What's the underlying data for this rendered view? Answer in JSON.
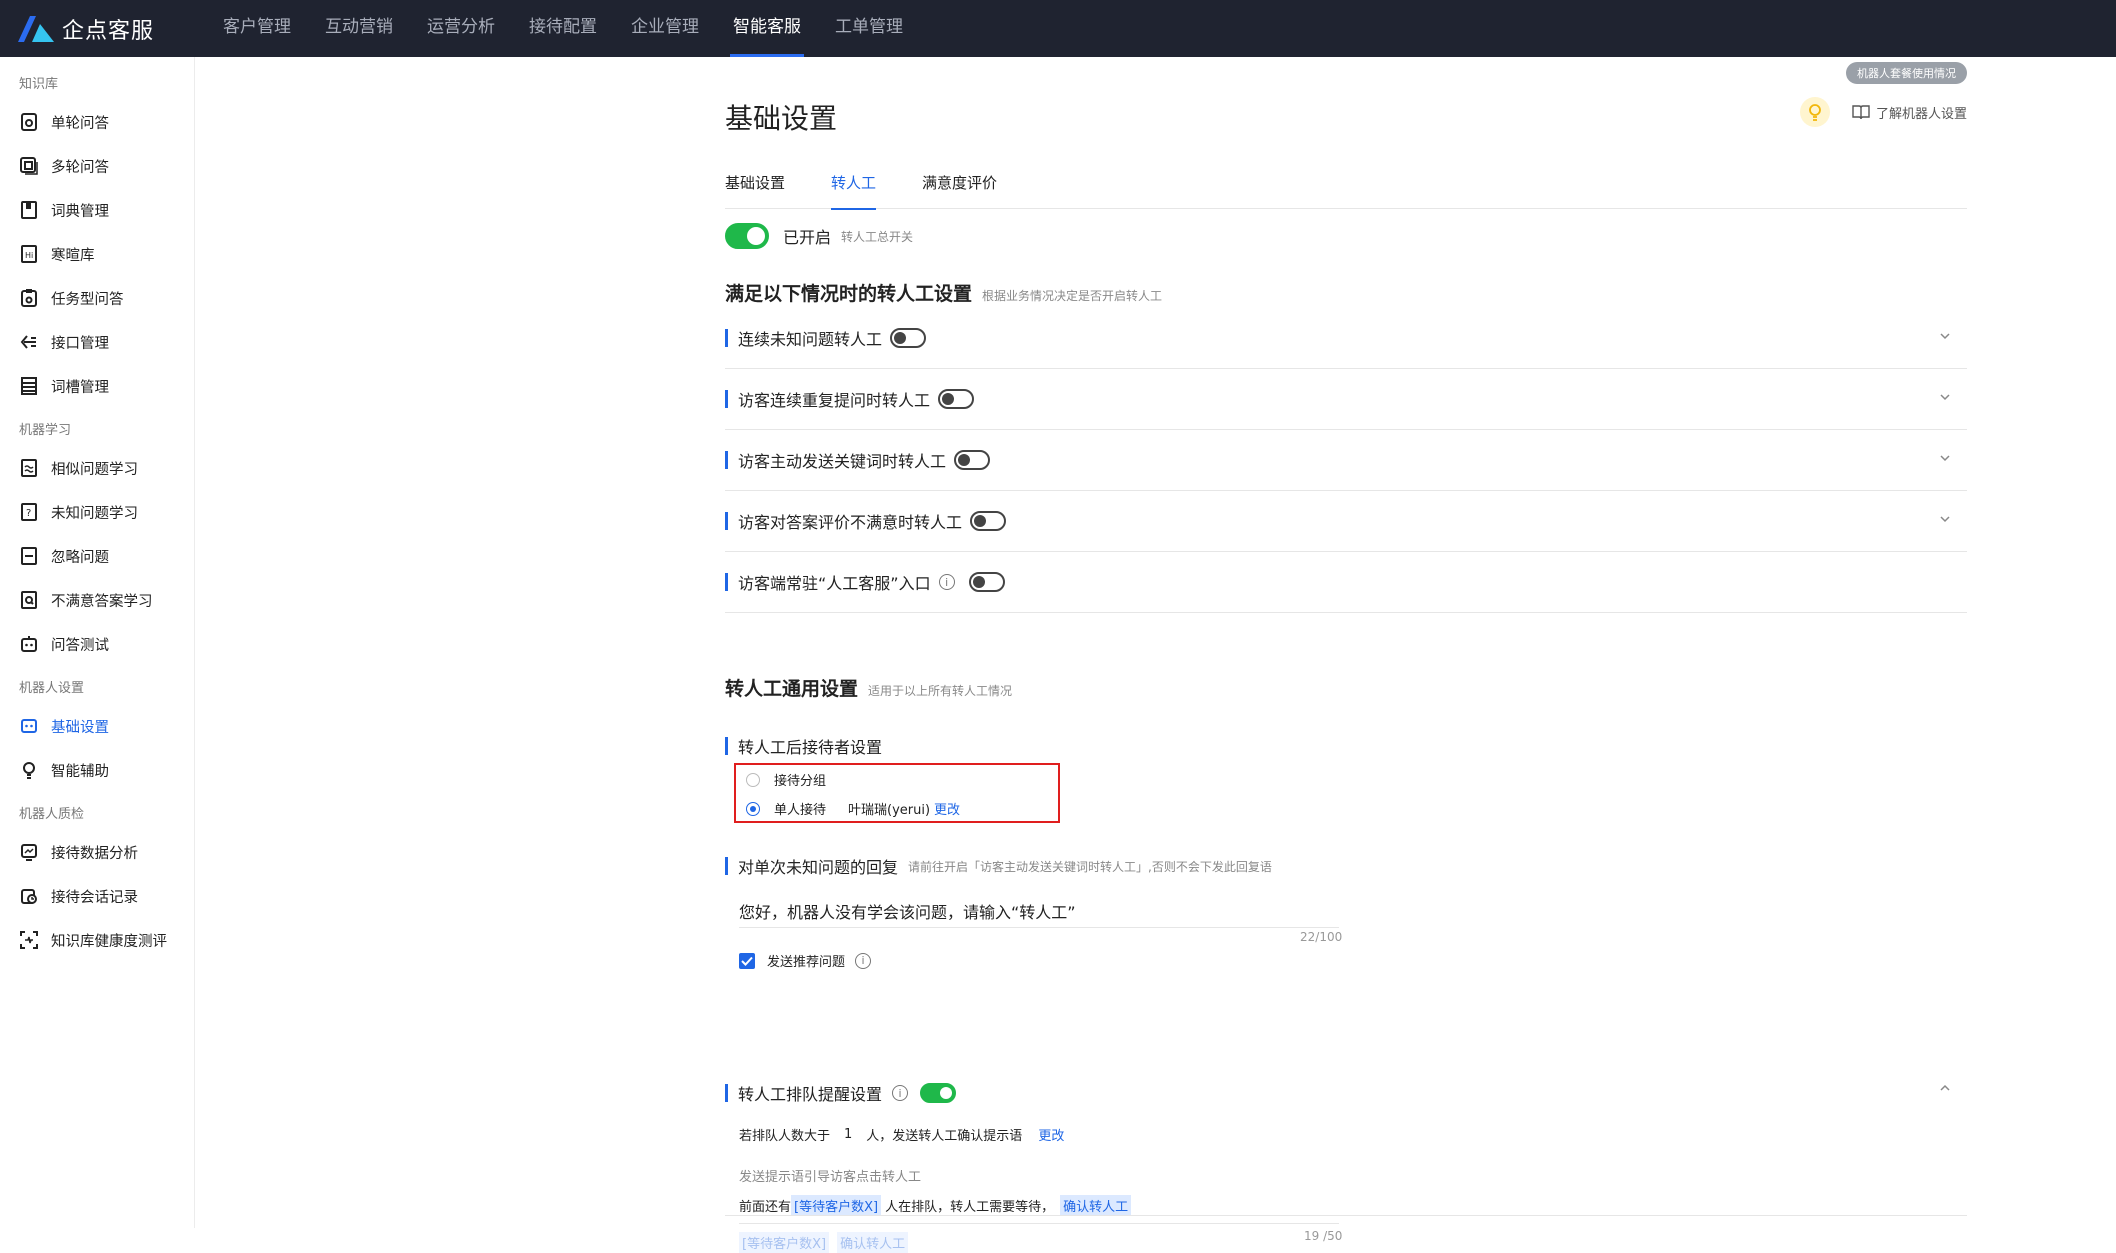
{
  "brand": {
    "name": "企点客服"
  },
  "nav": [
    "客户管理",
    "互动营销",
    "运营分析",
    "接待配置",
    "企业管理",
    "智能客服",
    "工单管理"
  ],
  "sidebar": {
    "groups": [
      {
        "label": "知识库",
        "items": [
          "单轮问答",
          "多轮问答",
          "词典管理",
          "寒暄库",
          "任务型问答",
          "接口管理",
          "词槽管理"
        ]
      },
      {
        "label": "机器学习",
        "items": [
          "相似问题学习",
          "未知问题学习",
          "忽略问题",
          "不满意答案学习",
          "问答测试"
        ]
      },
      {
        "label": "机器人设置",
        "items": [
          "基础设置",
          "智能辅助"
        ]
      },
      {
        "label": "机器人质检",
        "items": [
          "接待数据分析",
          "接待会话记录",
          "知识库健康度测评"
        ]
      }
    ]
  },
  "header": {
    "usage_pill": "机器人套餐使用情况",
    "title": "基础设置",
    "help_link": "了解机器人设置"
  },
  "tabs": [
    "基础设置",
    "转人工",
    "满意度评价"
  ],
  "master_switch": {
    "label": "已开启",
    "hint": "转人工总开关",
    "on": true
  },
  "conditions": {
    "title": "满足以下情况时的转人工设置",
    "hint": "根据业务情况决定是否开启转人工",
    "rules": [
      {
        "label": "连续未知问题转人工",
        "on": false
      },
      {
        "label": "访客连续重复提问时转人工",
        "on": false
      },
      {
        "label": "访客主动发送关键词时转人工",
        "on": false
      },
      {
        "label": "访客对答案评价不满意时转人工",
        "on": false
      },
      {
        "label": "访客端常驻“人工客服”入口",
        "on": false
      }
    ]
  },
  "general": {
    "title": "转人工通用设置",
    "hint": "适用于以上所有转人工情况",
    "receiver": {
      "title": "转人工后接待者设置",
      "options": [
        "接待分组",
        "单人接待"
      ],
      "selected": "单人接待",
      "person": "叶瑞瑞(yerui)",
      "change": "更改"
    },
    "unknown_reply": {
      "title": "对单次未知问题的回复",
      "hint": "请前往开启「访客主动发送关键词时转人工」,否则不会下发此回复语",
      "text": "您好，机器人没有学会该问题，请输入“转人工”",
      "counter": "22/100",
      "checkbox_label": "发送推荐问题"
    },
    "queue": {
      "title": "转人工排队提醒设置",
      "on": true,
      "line_prefix": "若排队人数大于",
      "count": "1",
      "line_suffix": "人，发送转人工确认提示语",
      "change": "更改",
      "guide": "发送提示语引导访客点击转人工",
      "msg_part1": "前面还有",
      "msg_tag1": "[等待客户数X]",
      "msg_part2": "人在排队，转人工需要等待，",
      "msg_tag2": "确认转人工",
      "insert_tag1": "[等待客户数X]",
      "insert_tag2": "确认转人工",
      "counter": "19 /50"
    }
  },
  "colors": {
    "accent": "#1f66e5",
    "switch_on": "#1fb84a",
    "topbar": "#1f2330",
    "highlight_border": "#e01e1e"
  }
}
